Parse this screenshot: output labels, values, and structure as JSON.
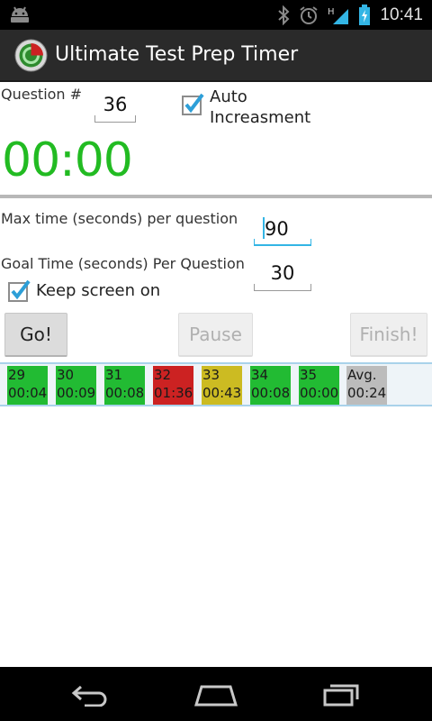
{
  "status_bar": {
    "time": "10:41",
    "icons": [
      "android-icon",
      "bluetooth-icon",
      "alarm-icon",
      "signal-icon",
      "battery-icon"
    ]
  },
  "app": {
    "title": "Ultimate Test Prep Timer"
  },
  "question": {
    "label": "Question #",
    "value": "36"
  },
  "auto_increment": {
    "label_line1": "Auto",
    "label_line2": "Increasment",
    "checked": true
  },
  "timer": {
    "display": "00:00",
    "color": "#22bb22"
  },
  "max_time": {
    "label": "Max time (seconds) per question",
    "value": "90"
  },
  "goal_time": {
    "label": "Goal Time (seconds) Per Question",
    "value": "30"
  },
  "keep_screen_on": {
    "label": "Keep screen on",
    "checked": true
  },
  "buttons": {
    "go": "Go!",
    "pause": "Pause",
    "finish": "Finish!"
  },
  "history": [
    {
      "question": "29",
      "time": "00:04",
      "color": "#22bb33"
    },
    {
      "question": "30",
      "time": "00:09",
      "color": "#22bb33"
    },
    {
      "question": "31",
      "time": "00:08",
      "color": "#22bb33"
    },
    {
      "question": "32",
      "time": "01:36",
      "color": "#cc2222"
    },
    {
      "question": "33",
      "time": "00:43",
      "color": "#ccbb22"
    },
    {
      "question": "34",
      "time": "00:08",
      "color": "#22bb33"
    },
    {
      "question": "35",
      "time": "00:00",
      "color": "#22bb33"
    },
    {
      "question": "Avg.",
      "time": "00:24",
      "color": "#bcbcbc"
    }
  ],
  "colors": {
    "accent": "#33b5e5",
    "timer_green": "#22bb22",
    "check_blue": "#2d9fd8"
  }
}
